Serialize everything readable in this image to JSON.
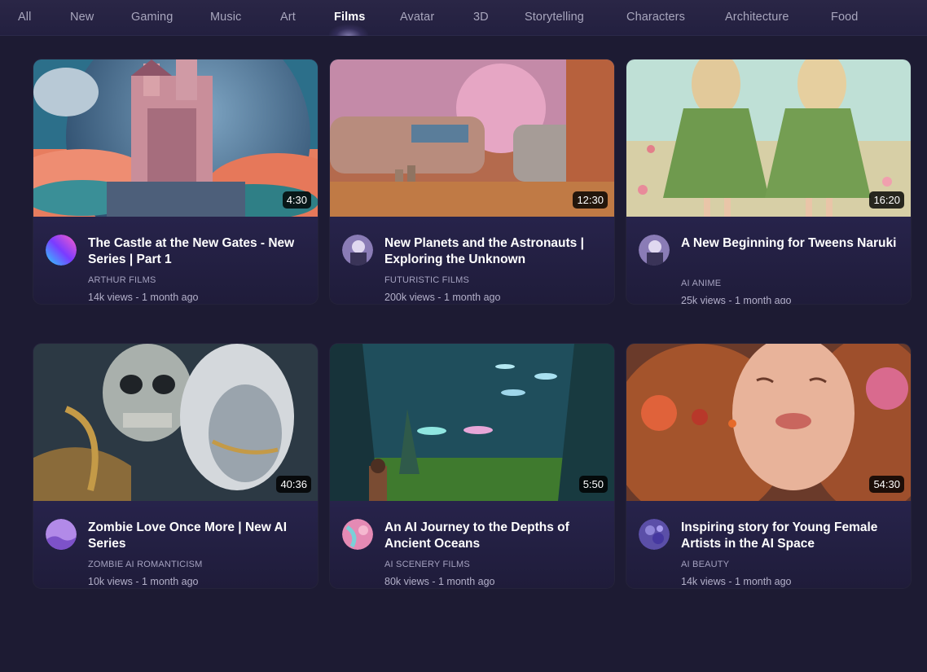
{
  "nav": {
    "tabs": [
      "All",
      "New",
      "Gaming",
      "Music",
      "Art",
      "Films",
      "Avatar",
      "3D",
      "Storytelling",
      "Characters",
      "Architecture",
      "Food"
    ],
    "active": "Films"
  },
  "videos": [
    {
      "title": "The Castle at the New Gates - New Series | Part 1",
      "channel": "ARTHUR FILMS",
      "meta": "14k views - 1 month ago",
      "duration": "4:30",
      "thumbnail": "castle-planet-thumbnail",
      "avatar": "gradient-orb-avatar"
    },
    {
      "title": "New Planets and the Astronauts | Exploring the Unknown",
      "channel": "FUTURISTIC FILMS",
      "meta": "200k views - 1 month ago",
      "duration": "12:30",
      "thumbnail": "desert-train-planet-thumbnail",
      "avatar": "figure-avatar"
    },
    {
      "title": "A New Beginning for Tweens Naruki",
      "channel": "AI ANIME",
      "meta": "25k views - 1 month ago",
      "duration": "16:20",
      "thumbnail": "flower-field-girls-thumbnail",
      "avatar": "figure-avatar"
    },
    {
      "title": "Zombie Love Once More | New AI Series",
      "channel": "ZOMBIE AI ROMANTICISM",
      "meta": "10k views - 1 month ago",
      "duration": "40:36",
      "thumbnail": "skeleton-couple-thumbnail",
      "avatar": "purple-landscape-avatar"
    },
    {
      "title": "An AI Journey to the Depths of Ancient Oceans",
      "channel": "AI SCENERY FILMS",
      "meta": "80k views - 1 month ago",
      "duration": "5:50",
      "thumbnail": "underwater-saucers-thumbnail",
      "avatar": "pink-abstract-avatar"
    },
    {
      "title": "Inspiring story for Young Female Artists in the AI Space",
      "channel": "AI BEAUTY",
      "meta": "14k views - 1 month ago",
      "duration": "54:30",
      "thumbnail": "dreaming-woman-thumbnail",
      "avatar": "violet-floral-avatar"
    }
  ]
}
